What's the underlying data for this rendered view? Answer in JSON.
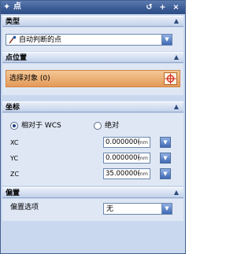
{
  "window": {
    "title": "点",
    "buttons": [
      "↺",
      "+",
      "×"
    ]
  },
  "type_section": {
    "header": "类型",
    "combo_value": "自动判断的点"
  },
  "point_location": {
    "header": "点位置",
    "select_label": "选择对象 (0)"
  },
  "coordinates": {
    "header": "坐标",
    "radio_wcs": "相对于 WCS",
    "radio_abs": "绝对",
    "rows": [
      {
        "axis": "XC",
        "value": "0.000000(",
        "unit": "mm"
      },
      {
        "axis": "YC",
        "value": "0.000000(",
        "unit": "mm"
      },
      {
        "axis": "ZC",
        "value": "35.00000(",
        "unit": "mm"
      }
    ]
  },
  "offset": {
    "header": "偏置",
    "label": "偏置选项",
    "value": "无"
  },
  "icons": {
    "app": "point-icon",
    "combo_type": "inferred-point-icon",
    "pick": "crosshair-icon"
  },
  "colors": {
    "title_bar": "#3a5a93",
    "panel": "#dfe7f4",
    "highlight": "#e8a866",
    "crosshair": "#d2301f"
  }
}
